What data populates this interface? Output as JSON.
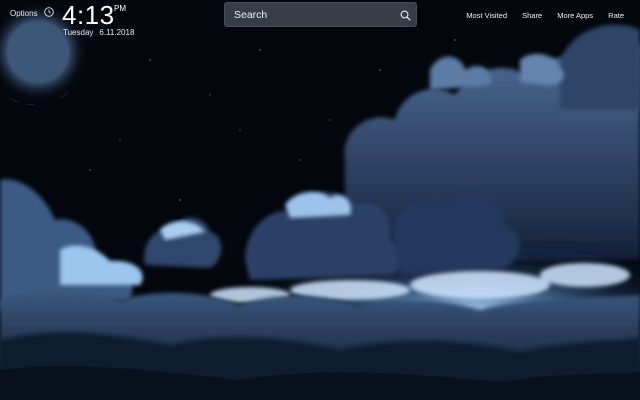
{
  "header": {
    "options_label": "Options",
    "clock_icon": "clock-icon",
    "time": "4:13",
    "ampm": "PM",
    "weekday": "Tuesday",
    "date": "6.11.2018"
  },
  "search": {
    "placeholder": "Search",
    "icon": "search-icon"
  },
  "nav": {
    "items": [
      {
        "label": "Most Visited"
      },
      {
        "label": "Share"
      },
      {
        "label": "More Apps"
      },
      {
        "label": "Rate"
      }
    ]
  },
  "colors": {
    "sky": "#03060c",
    "cloud_glow": "#9fc7f0",
    "cloud_dark": "#1c2c44",
    "moon": "#d9e6f5",
    "search_bg": "#3c424a"
  }
}
